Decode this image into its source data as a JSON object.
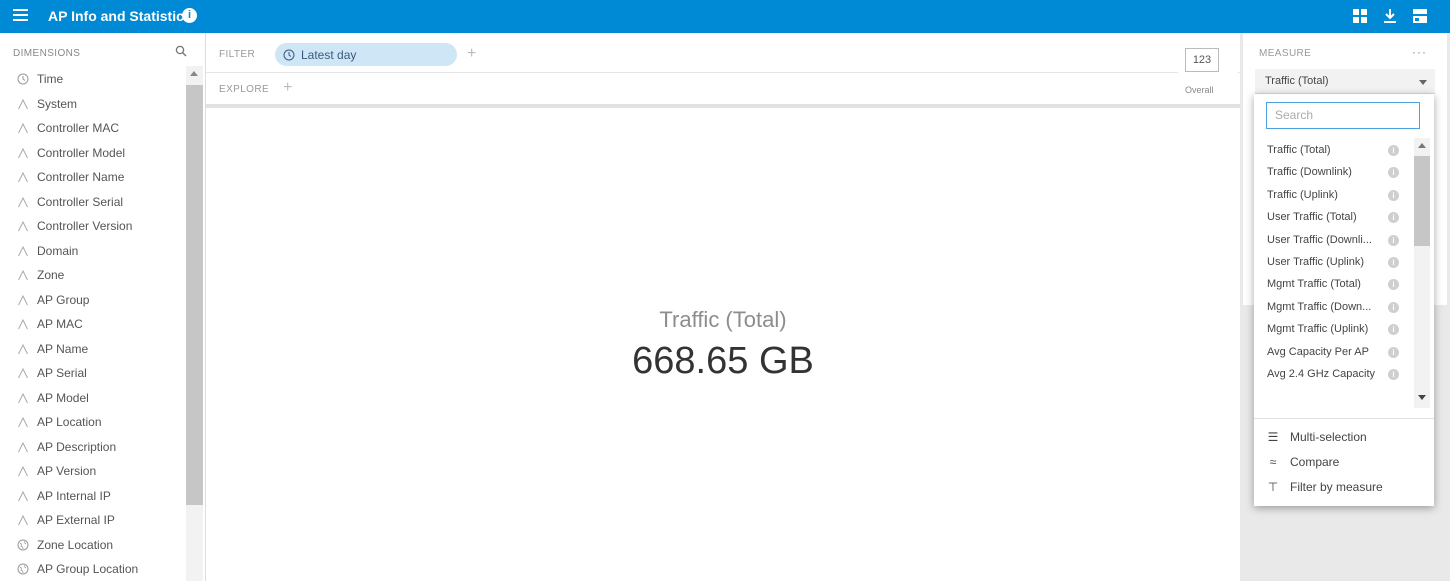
{
  "header": {
    "title": "AP Info and Statistics"
  },
  "dimensions": {
    "header": "DIMENSIONS",
    "items": [
      {
        "label": "Time",
        "icon": "clock-icon"
      },
      {
        "label": "System",
        "icon": "string-dimension-icon"
      },
      {
        "label": "Controller MAC",
        "icon": "string-dimension-icon"
      },
      {
        "label": "Controller Model",
        "icon": "string-dimension-icon"
      },
      {
        "label": "Controller Name",
        "icon": "string-dimension-icon"
      },
      {
        "label": "Controller Serial",
        "icon": "string-dimension-icon"
      },
      {
        "label": "Controller Version",
        "icon": "string-dimension-icon"
      },
      {
        "label": "Domain",
        "icon": "string-dimension-icon"
      },
      {
        "label": "Zone",
        "icon": "string-dimension-icon"
      },
      {
        "label": "AP Group",
        "icon": "string-dimension-icon"
      },
      {
        "label": "AP MAC",
        "icon": "string-dimension-icon"
      },
      {
        "label": "AP Name",
        "icon": "string-dimension-icon"
      },
      {
        "label": "AP Serial",
        "icon": "string-dimension-icon"
      },
      {
        "label": "AP Model",
        "icon": "string-dimension-icon"
      },
      {
        "label": "AP Location",
        "icon": "string-dimension-icon"
      },
      {
        "label": "AP Description",
        "icon": "string-dimension-icon"
      },
      {
        "label": "AP Version",
        "icon": "string-dimension-icon"
      },
      {
        "label": "AP Internal IP",
        "icon": "string-dimension-icon"
      },
      {
        "label": "AP External IP",
        "icon": "string-dimension-icon"
      },
      {
        "label": "Zone Location",
        "icon": "globe-icon"
      },
      {
        "label": "AP Group Location",
        "icon": "globe-icon"
      }
    ]
  },
  "filter": {
    "label": "FILTER",
    "pill": "Latest day"
  },
  "explore": {
    "label": "EXPLORE"
  },
  "overall": {
    "box": "123",
    "caption": "Overall"
  },
  "main": {
    "measure_label": "Traffic (Total)",
    "measure_value": "668.65 GB"
  },
  "measure": {
    "header": "MEASURE",
    "more": "···",
    "selected": "Traffic (Total)",
    "search_placeholder": "Search",
    "options": [
      "Traffic (Total)",
      "Traffic (Downlink)",
      "Traffic (Uplink)",
      "User Traffic (Total)",
      "User Traffic (Downli...",
      "User Traffic (Uplink)",
      "Mgmt Traffic (Total)",
      "Mgmt Traffic (Down...",
      "Mgmt Traffic (Uplink)",
      "Avg Capacity Per AP",
      "Avg 2.4 GHz Capacity"
    ],
    "actions": [
      {
        "label": "Multi-selection",
        "icon": "list-icon"
      },
      {
        "label": "Compare",
        "icon": "compare-icon"
      },
      {
        "label": "Filter by measure",
        "icon": "filter-measure-icon"
      }
    ]
  },
  "colors": {
    "brand": "#0089d5",
    "pill": "#cfe6f7"
  }
}
